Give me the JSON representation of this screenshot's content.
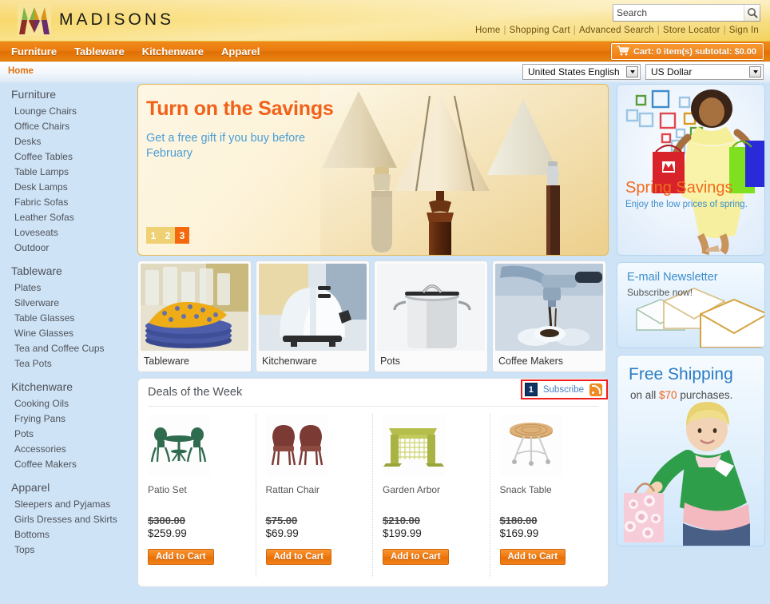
{
  "brand": {
    "name": "MADISONS"
  },
  "search": {
    "value": "Search",
    "placeholder": "Search",
    "icon": "search-icon"
  },
  "top_links": [
    {
      "label": "Home"
    },
    {
      "label": "Shopping Cart"
    },
    {
      "label": "Advanced Search"
    },
    {
      "label": "Store Locator"
    },
    {
      "label": "Sign In"
    }
  ],
  "nav": [
    {
      "label": "Furniture"
    },
    {
      "label": "Tableware"
    },
    {
      "label": "Kitchenware"
    },
    {
      "label": "Apparel"
    }
  ],
  "cart": {
    "label": "Cart: 0 item(s) subtotal: $0.00",
    "icon": "shopping-cart-icon"
  },
  "breadcrumb": {
    "label": "Home"
  },
  "selectors": {
    "language": {
      "value": "United States English"
    },
    "currency": {
      "value": "US Dollar"
    }
  },
  "sidebar": {
    "groups": [
      {
        "title": "Furniture",
        "items": [
          {
            "label": "Lounge Chairs"
          },
          {
            "label": "Office Chairs"
          },
          {
            "label": "Desks"
          },
          {
            "label": "Coffee Tables"
          },
          {
            "label": "Table Lamps"
          },
          {
            "label": "Desk Lamps"
          },
          {
            "label": "Fabric Sofas"
          },
          {
            "label": "Leather Sofas"
          },
          {
            "label": "Loveseats"
          },
          {
            "label": "Outdoor"
          }
        ]
      },
      {
        "title": "Tableware",
        "items": [
          {
            "label": "Plates"
          },
          {
            "label": "Silverware"
          },
          {
            "label": "Table Glasses"
          },
          {
            "label": "Wine Glasses"
          },
          {
            "label": "Tea and Coffee Cups"
          },
          {
            "label": "Tea Pots"
          }
        ]
      },
      {
        "title": "Kitchenware",
        "items": [
          {
            "label": "Cooking Oils"
          },
          {
            "label": "Frying Pans"
          },
          {
            "label": "Pots"
          },
          {
            "label": "Accessories"
          },
          {
            "label": "Coffee Makers"
          }
        ]
      },
      {
        "title": "Apparel",
        "items": [
          {
            "label": "Sleepers and Pyjamas"
          },
          {
            "label": "Girls Dresses and Skirts"
          },
          {
            "label": "Bottoms"
          },
          {
            "label": "Tops"
          }
        ]
      }
    ]
  },
  "banner": {
    "title": "Turn on the Savings",
    "subtitle": "Get a free gift if you buy before February",
    "pages": [
      "1",
      "2",
      "3"
    ],
    "active_page": "3",
    "image": "table-lamps-photo"
  },
  "tiles": [
    {
      "label": "Tableware",
      "image": "napkins-and-plates-photo"
    },
    {
      "label": "Kitchenware",
      "image": "toaster-photo"
    },
    {
      "label": "Pots",
      "image": "stock-pot-photo"
    },
    {
      "label": "Coffee Makers",
      "image": "espresso-machine-photo"
    }
  ],
  "deals": {
    "title": "Deals of the Week",
    "subscribe_label": "Subscribe",
    "rss_icon": "rss-icon",
    "marker": "1",
    "add_to_cart_label": "Add to Cart",
    "products": [
      {
        "name": "Patio Set",
        "old_price": "$300.00",
        "new_price": "$259.99",
        "image": "patio-set-photo"
      },
      {
        "name": "Rattan Chair",
        "old_price": "$75.00",
        "new_price": "$69.99",
        "image": "rattan-chair-photo"
      },
      {
        "name": "Garden Arbor",
        "old_price": "$210.00",
        "new_price": "$199.99",
        "image": "garden-arbor-photo"
      },
      {
        "name": "Snack Table",
        "old_price": "$180.00",
        "new_price": "$169.99",
        "image": "snack-table-photo"
      }
    ]
  },
  "promos": {
    "spring": {
      "title": "Spring Savings",
      "subtitle": "Enjoy the low prices of spring.",
      "image": "woman-with-shopping-bags-photo"
    },
    "newsletter": {
      "title": "E-mail Newsletter",
      "subtitle": "Subscribe now!",
      "image": "envelopes-illustration"
    },
    "shipping": {
      "title": "Free Shipping",
      "subtitle_pre": "on all ",
      "amount": "$70",
      "subtitle_post": " purchases.",
      "image": "woman-with-pink-bag-photo"
    }
  },
  "colors": {
    "brand_orange": "#e86f05",
    "header_gold": "#f6cf52",
    "page_blue": "#cfe3f7",
    "link_blue": "#4a7fbf",
    "marker_navy": "#123464",
    "highlight_red": "#f41c1c"
  }
}
